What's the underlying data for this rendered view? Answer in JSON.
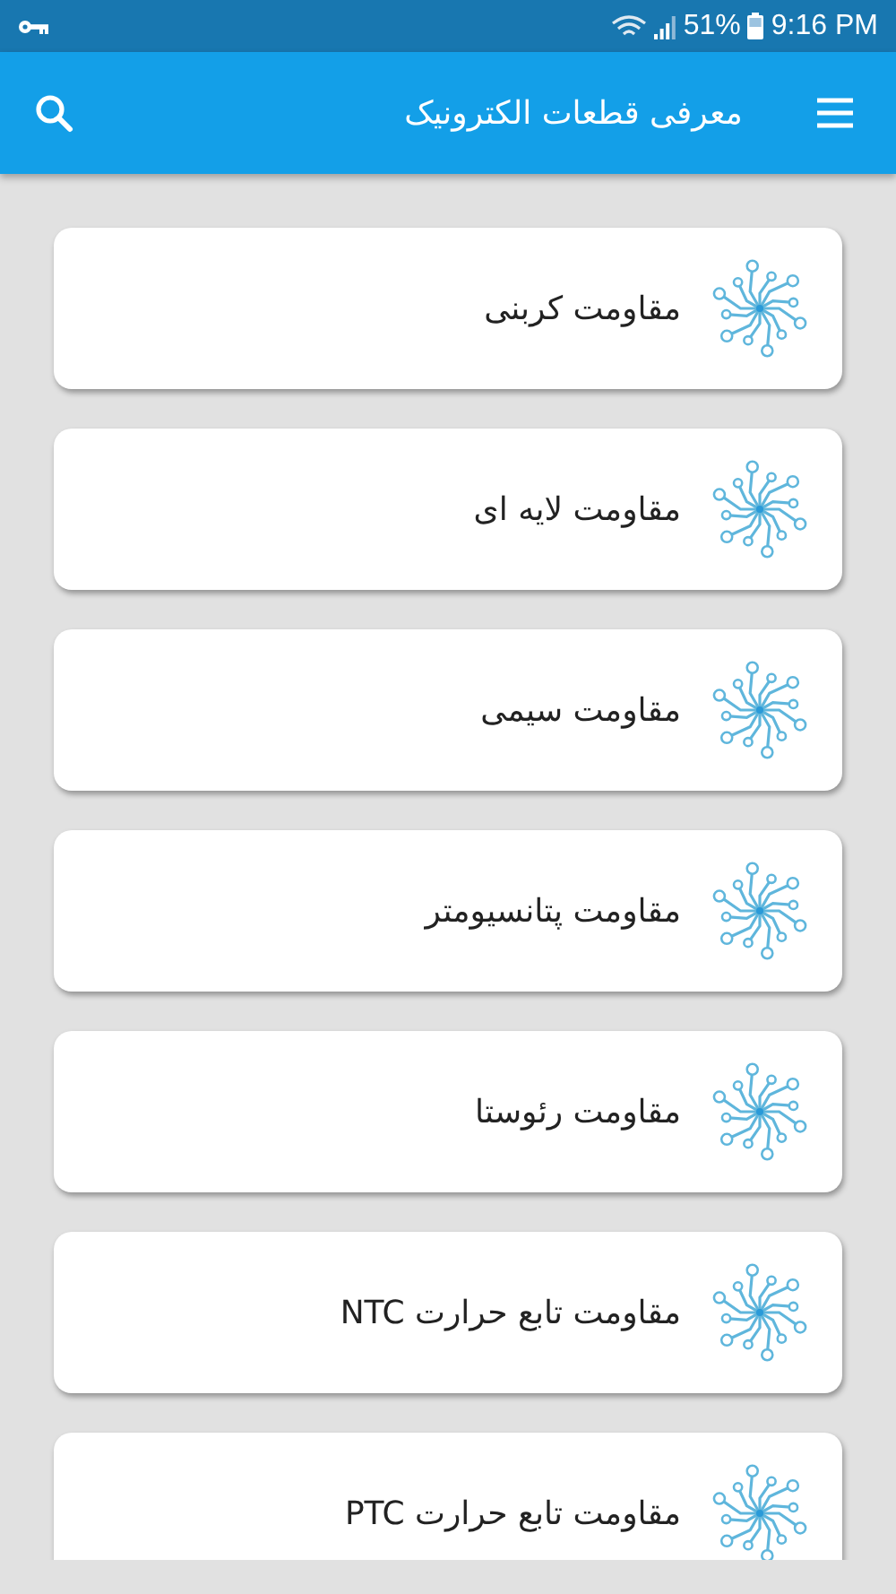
{
  "status_bar": {
    "battery": "51%",
    "time": "9:16 PM"
  },
  "app_bar": {
    "title": "معرفی قطعات الکترونیک"
  },
  "items": [
    {
      "label": "مقاومت کربنی"
    },
    {
      "label": "مقاومت لایه ای"
    },
    {
      "label": "مقاومت سیمی"
    },
    {
      "label": "مقاومت پتانسیومتر"
    },
    {
      "label": "مقاومت رئوستا"
    },
    {
      "label": "مقاومت تابع حرارت NTC"
    },
    {
      "label": "مقاومت تابع حرارت PTC"
    }
  ]
}
